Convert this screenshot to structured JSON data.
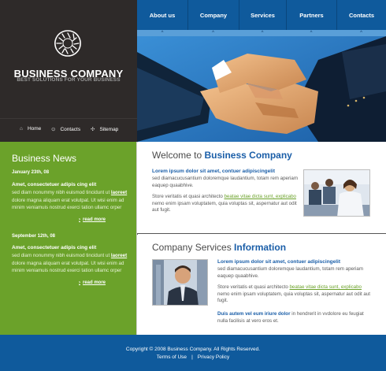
{
  "brand": {
    "title": "BUSINESS COMPANY",
    "tagline": "BEST SOLUTIONS FOR YOUR BUSINESS",
    "logo_icon": "swirl-ring-icon"
  },
  "utility_nav": [
    {
      "label": "Home",
      "icon": "home-icon"
    },
    {
      "label": "Contacts",
      "icon": "contacts-icon"
    },
    {
      "label": "Sitemap",
      "icon": "sitemap-icon"
    }
  ],
  "nav": [
    "About us",
    "Company",
    "Services",
    "Partners",
    "Contacts"
  ],
  "hero": {
    "image": "handshake-photo"
  },
  "news": {
    "heading": "Business News",
    "items": [
      {
        "date": "January 23th, 08",
        "lead": "Amet, consectetuer adipis cing elit",
        "body_1": "sed diam nonummy nibh euismod tincidunt ut ",
        "highlight": "laoreet",
        "body_2": " dolore magna aliquam erat volutpat.  Ut wisi enim ad minim veniamuis nostrud exerci tation ullamc orper",
        "more": "read more"
      },
      {
        "date": "September 12th, 08",
        "lead": "Amet, consectetuer adipis cing elit",
        "body_1": "sed diam nonummy nibh euismod tincidunt ut ",
        "highlight": "laoreet",
        "body_2": " dolore magna aliquam erat volutpat.  Ut wisi enim ad minim veniamuis nostrud exerci tation ullamc orper",
        "more": "read more"
      }
    ]
  },
  "welcome": {
    "title_plain": "Welcome to ",
    "title_accent": "Business Company",
    "lead": "Lorem ipsum dolor sit amet, contuer adipiscingelit",
    "para1": "sed diamacucusantium doloremque laudantium, totam rem aperiam eaquep quaabhive.",
    "para2_a": "Store veritatis et quasi architecto ",
    "para2_link": "beatae vitae dicta sunt, explicabo",
    "para2_b": " nemo enim ipsam voluptatem, quia voluptas sit, aspernatur aut odit aut fugit.",
    "image": "office-team-photo"
  },
  "services": {
    "title_plain": "Company Services ",
    "title_accent": "Information",
    "lead": "Lorem ipsum dolor sit amet, contuer adipiscingelit",
    "para1": "sed diamacucusantium doloremque laudantium, totam rem aperiam eaquep quaabhive.",
    "para2_a": "Store veritatis et quasi architecto ",
    "para2_link": "beatae vitae dicta sunt, explicabo",
    "para2_b": " nemo enim ipsam voluptatem, quia voluptas sit, aspernatur aut odit aut fugit.",
    "para3_bold": "Duis autem vel eum iriure dolor",
    "para3_rest": " in hendrerit in vvdolore eu feugiat nulla facilisis at vero eros et.",
    "image": "businessman-photo"
  },
  "footer": {
    "copyright": "Copyright © 2008 Business Company. All Rights Reserved.",
    "links": [
      "Terms of Use",
      "Privacy Policy"
    ]
  },
  "colors": {
    "dark_panel": "#2e2a29",
    "nav_blue": "#0f5a9c",
    "accent_blue": "#1a5ea8",
    "news_green": "#6ba22a"
  }
}
